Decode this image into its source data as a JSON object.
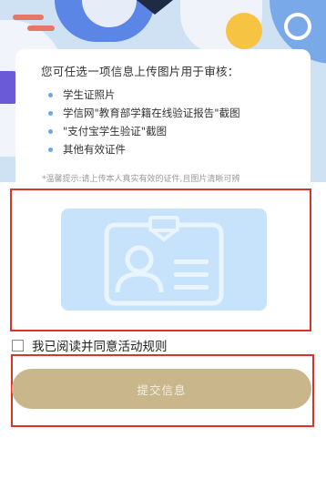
{
  "instructions": {
    "intro": "您可任选一项信息上传图片用于审核：",
    "options": [
      "学生证照片",
      "学信网\"教育部学籍在线验证报告\"截图",
      "\"支付宝学生验证\"截图",
      "其他有效证件"
    ],
    "tip": "*温馨提示:请上传本人真实有效的证件,且图片清晰可辨"
  },
  "upload": {
    "icon": "id-card-icon",
    "background_color": "#c7e3fb"
  },
  "agreement": {
    "checked": false,
    "label": "我已阅读并同意活动规则"
  },
  "submit": {
    "label": "提交信息",
    "color": "#c9b68a"
  },
  "highlight_color": "#d9342b"
}
